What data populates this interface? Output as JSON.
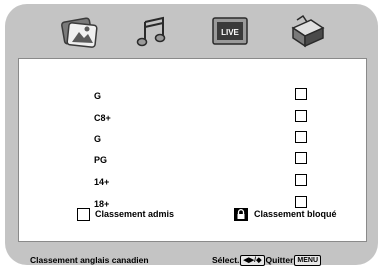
{
  "tabs": [
    {
      "icon": "picture-icon"
    },
    {
      "icon": "music-notes-icon"
    },
    {
      "icon": "live-tv-icon",
      "label": "LIVE"
    },
    {
      "icon": "setup-box-icon"
    }
  ],
  "ratings": [
    {
      "label": "G",
      "checked": false
    },
    {
      "label": "C8+",
      "checked": false
    },
    {
      "label": "G",
      "checked": false
    },
    {
      "label": "PG",
      "checked": false
    },
    {
      "label": "14+",
      "checked": false
    },
    {
      "label": "18+",
      "checked": false
    }
  ],
  "legend": {
    "allowed_label": "Classement admis",
    "blocked_label": "Classement bloqué"
  },
  "status": {
    "title": "Classement anglais canadien",
    "select_label": "Sélect.",
    "nav_key": "◀▶/◆",
    "quit_label": "Quitter",
    "menu_key": "MENU"
  }
}
